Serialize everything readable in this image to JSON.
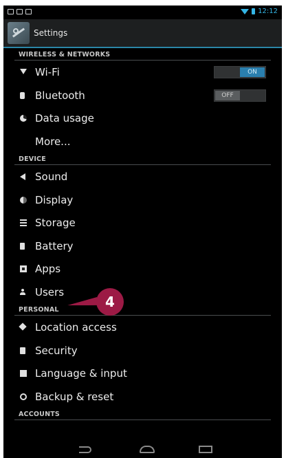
{
  "status_bar": {
    "time": "12:12"
  },
  "action_bar": {
    "title": "Settings"
  },
  "sections": {
    "wireless": "WIRELESS & NETWORKS",
    "device": "DEVICE",
    "personal": "PERSONAL",
    "accounts": "ACCOUNTS"
  },
  "items": {
    "wifi": "Wi-Fi",
    "bluetooth": "Bluetooth",
    "data_usage": "Data usage",
    "more": "More...",
    "sound": "Sound",
    "display": "Display",
    "storage": "Storage",
    "battery": "Battery",
    "apps": "Apps",
    "users": "Users",
    "location": "Location access",
    "security": "Security",
    "language": "Language & input",
    "backup": "Backup & reset"
  },
  "toggles": {
    "wifi": "ON",
    "bluetooth": "OFF"
  },
  "callout": {
    "number": "4"
  },
  "colors": {
    "accent": "#34b5e5",
    "callout": "#9c1a45"
  }
}
